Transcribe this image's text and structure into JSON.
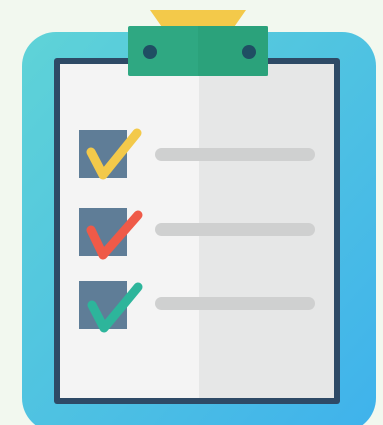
{
  "illustration": {
    "subject": "clipboard-checklist-icon",
    "colors": {
      "background": "#f2f8ef",
      "board_gradient_start": "#5fd3d7",
      "board_gradient_end": "#3fb2ec",
      "frame_outline": "#2e4a66",
      "paper_left": "#f4f4f4",
      "paper_right": "#e6e7e7",
      "clip_top": "#f3c94a",
      "clip_body": "#2fa882",
      "clip_hole": "#1f4e63",
      "checkbox": "#5f7d97",
      "check_yellow": "#f3c94a",
      "check_red": "#ef5a48",
      "check_teal": "#2db59b",
      "line_color": "#cfd0d0"
    },
    "checklist": {
      "items": [
        {
          "checked": true,
          "check_color": "yellow"
        },
        {
          "checked": true,
          "check_color": "red"
        },
        {
          "checked": true,
          "check_color": "teal"
        }
      ]
    }
  }
}
